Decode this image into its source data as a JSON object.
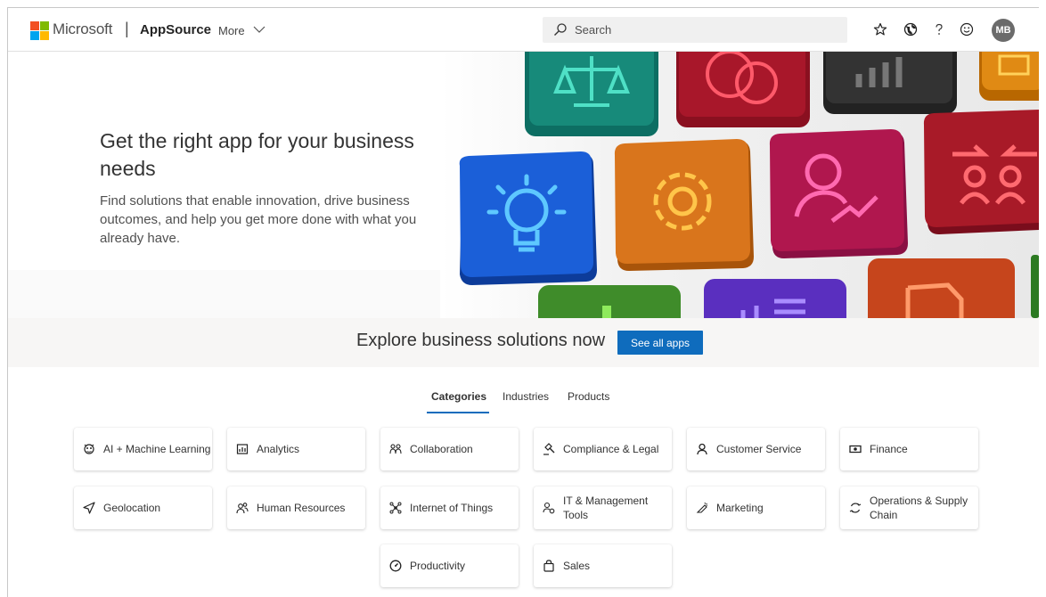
{
  "header": {
    "brand": "Microsoft",
    "separator": "|",
    "product": "AppSource",
    "more_label": "More",
    "search_placeholder": "Search",
    "icons": [
      "star-icon",
      "globe-icon",
      "help-icon",
      "feedback-smiley-icon"
    ],
    "avatar_initials": "MB"
  },
  "hero": {
    "title": "Get the right app for your business needs",
    "subtitle": "Find solutions that enable innovation, drive business outcomes, and help you get more done with what you already have.",
    "tile_icons": [
      "scales-icon",
      "coins-icon",
      "bar-chart-icon",
      "document-icon",
      "lightbulb-icon",
      "gear-icon",
      "person-growth-icon",
      "people-exchange-icon",
      "bar-icon",
      "chart-icon",
      "document-edit-icon"
    ]
  },
  "explore": {
    "text": "Explore business solutions now",
    "button": "See all apps"
  },
  "tabs": [
    {
      "label": "Categories",
      "active": true
    },
    {
      "label": "Industries",
      "active": false
    },
    {
      "label": "Products",
      "active": false
    }
  ],
  "categories": [
    {
      "label": "AI + Machine Learning",
      "icon": "ai-brain-icon"
    },
    {
      "label": "Analytics",
      "icon": "analytics-icon"
    },
    {
      "label": "Collaboration",
      "icon": "collaboration-icon"
    },
    {
      "label": "Compliance & Legal",
      "icon": "gavel-icon"
    },
    {
      "label": "Customer Service",
      "icon": "person-icon"
    },
    {
      "label": "Finance",
      "icon": "money-icon"
    },
    {
      "label": "Geolocation",
      "icon": "location-arrow-icon"
    },
    {
      "label": "Human Resources",
      "icon": "people-icon"
    },
    {
      "label": "Internet of Things",
      "icon": "iot-icon"
    },
    {
      "label": "IT & Management Tools",
      "icon": "it-tools-icon"
    },
    {
      "label": "Marketing",
      "icon": "megaphone-icon"
    },
    {
      "label": "Operations & Supply Chain",
      "icon": "cycle-icon"
    },
    {
      "label": "Productivity",
      "icon": "gauge-icon"
    },
    {
      "label": "Sales",
      "icon": "shopping-bag-icon"
    }
  ],
  "colors": {
    "accent": "#0f6cbd",
    "tile_blue": "#1b5fd8",
    "tile_orange": "#d9751c",
    "tile_magenta": "#b0174e",
    "tile_red": "#a8172a",
    "tile_teal": "#178a7a",
    "tile_green": "#3f8c2a",
    "tile_purple": "#5a2fbf"
  }
}
